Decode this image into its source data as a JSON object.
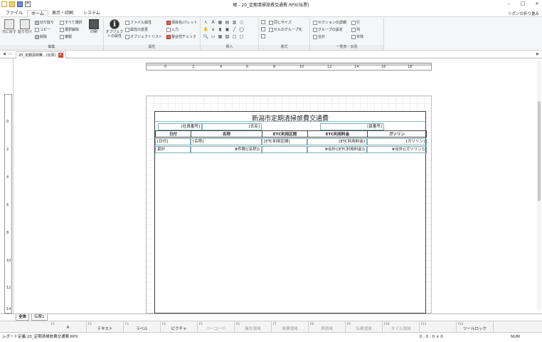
{
  "window": {
    "title": "帳 - 20_定期清掃旅費交通費.RPX(伝票)",
    "controls": [
      "–",
      "□",
      "×"
    ]
  },
  "quick_access": [
    "new",
    "open",
    "save",
    "undo"
  ],
  "menu": {
    "tabs": [
      {
        "label": "ファイル"
      },
      {
        "label": "ホーム"
      },
      {
        "label": "表示・印刷"
      },
      {
        "label": "システム"
      }
    ],
    "active": "ホーム",
    "ribbon_collapse": "リボンの折り畳み"
  },
  "ribbon": {
    "groups": [
      {
        "label": "編集"
      },
      {
        "label": "属性"
      },
      {
        "label": "挿入"
      },
      {
        "label": "書式"
      },
      {
        "label": "一覧表・伝票"
      }
    ],
    "edit": {
      "undo": "元に戻す",
      "paste": "貼り付け",
      "cut": "切り取り",
      "copy": "コピー",
      "delete": "削除",
      "select_all": "すべて選択",
      "deselect": "選択解除",
      "duplicate": "複製",
      "print": "印刷"
    },
    "attr": {
      "object_attr": "オブジェクトの属性",
      "file_attr": "ファイル属性",
      "attr_change": "属性の変更",
      "object_list": "オブジェクトリスト",
      "item_palette": "項目名/パレット",
      "input": "入力",
      "consistency": "整合性チェック"
    },
    "format": {
      "same_size": "同じサイズ",
      "section_group": "セルのグループ化"
    },
    "list": {
      "section_detail": "セクションの詳細",
      "group_setting": "グループの設定",
      "row": "行",
      "column": "列",
      "total": "合計",
      "body": "本体"
    }
  },
  "doc_tab": {
    "label": "20_定期清掃費...(伝票)"
  },
  "ruler": {
    "h_numbers": [
      "0",
      "2",
      "4",
      "6",
      "8",
      "10",
      "12",
      "14",
      "16",
      "18"
    ],
    "v_numbers": [
      "0",
      "2",
      "4",
      "6",
      "8",
      "10",
      "12",
      "14"
    ]
  },
  "form": {
    "title": "新潟市定期清掃旅費交通費",
    "emp_no": "[社員番号]",
    "name_field": "[氏名]",
    "slip_no": "[頁番号]",
    "headers": [
      "日付",
      "名称",
      "ETC利用区間",
      "ETC利用料金",
      "ガソリン"
    ],
    "row1": [
      "[日付]",
      "[名称]",
      "[ETC利用区間]",
      "[ETC利用料金]",
      "[ガソリン]"
    ],
    "row2": [
      "頁計",
      "#件数([名称])",
      "",
      "#合計([ETC利用料金])",
      "#合計([ガソリン])"
    ]
  },
  "sheet_tabs": [
    {
      "label": "全体"
    },
    {
      "label": "伝票1"
    }
  ],
  "function_keys": [
    {
      "num": "F1",
      "label": "A"
    },
    {
      "num": "F2",
      "label": "テキスト"
    },
    {
      "num": "F3",
      "label": "ラベル"
    },
    {
      "num": "F4",
      "label": "ピクチャ"
    },
    {
      "num": "F5",
      "label": "バーコード"
    },
    {
      "num": "F6",
      "label": "集計領域"
    },
    {
      "num": "F7",
      "label": "単票領域"
    },
    {
      "num": "F8",
      "label": "表領域"
    },
    {
      "num": "F9",
      "label": "伝票領域"
    },
    {
      "num": "F10",
      "label": "タイル領域"
    },
    {
      "num": "F11",
      "label": ""
    },
    {
      "num": "F12",
      "label": "ツールロック"
    }
  ],
  "status": {
    "file": "レポート定義:20_定期清掃旅費交通費.RPX",
    "coord": "0 , 0 : 0 × 0",
    "num": "NUM"
  }
}
